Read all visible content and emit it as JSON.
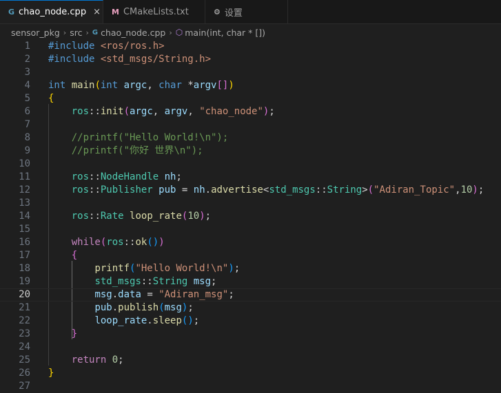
{
  "tabs": [
    {
      "icon": "C++",
      "label": "chao_node.cpp",
      "close": "×"
    },
    {
      "icon": "M",
      "label": "CMakeLists.txt"
    },
    {
      "icon": "⚙",
      "label": "设置"
    }
  ],
  "breadcrumb": {
    "folder1": "sensor_pkg",
    "folder2": "src",
    "file": "chao_node.cpp",
    "symbol": "main(int, char * [])",
    "separator": "›"
  },
  "editor": {
    "current_line": 20,
    "lines": [
      {
        "n": "1",
        "tokens": [
          [
            "#include ",
            "kw"
          ],
          [
            "<ros/ros.h>",
            "str"
          ]
        ]
      },
      {
        "n": "2",
        "tokens": [
          [
            "#include ",
            "kw"
          ],
          [
            "<std_msgs/String.h>",
            "str"
          ]
        ]
      },
      {
        "n": "3",
        "tokens": []
      },
      {
        "n": "4",
        "tokens": [
          [
            "int ",
            "kw"
          ],
          [
            "main",
            "fn"
          ],
          [
            "(",
            "br1"
          ],
          [
            "int ",
            "kw"
          ],
          [
            "argc",
            "var"
          ],
          [
            ", ",
            "pl"
          ],
          [
            "char ",
            "kw"
          ],
          [
            "*",
            "pl"
          ],
          [
            "argv",
            "var"
          ],
          [
            "[]",
            "br2"
          ],
          [
            ")",
            "br1"
          ]
        ]
      },
      {
        "n": "5",
        "tokens": [
          [
            "{",
            "br1"
          ]
        ]
      },
      {
        "n": "6",
        "tokens": [
          [
            "    ",
            "pl"
          ],
          [
            "ros",
            "ns"
          ],
          [
            "::",
            "pl"
          ],
          [
            "init",
            "fn"
          ],
          [
            "(",
            "br2"
          ],
          [
            "argc",
            "var"
          ],
          [
            ", ",
            "pl"
          ],
          [
            "argv",
            "var"
          ],
          [
            ", ",
            "pl"
          ],
          [
            "\"chao_node\"",
            "str"
          ],
          [
            ")",
            "br2"
          ],
          [
            ";",
            "pl"
          ]
        ]
      },
      {
        "n": "7",
        "tokens": []
      },
      {
        "n": "8",
        "tokens": [
          [
            "    ",
            "pl"
          ],
          [
            "//printf(\"Hello World!\\n\");",
            "com"
          ]
        ]
      },
      {
        "n": "9",
        "tokens": [
          [
            "    ",
            "pl"
          ],
          [
            "//printf(\"你好 世界\\n\");",
            "com"
          ]
        ]
      },
      {
        "n": "10",
        "tokens": []
      },
      {
        "n": "11",
        "tokens": [
          [
            "    ",
            "pl"
          ],
          [
            "ros",
            "ns"
          ],
          [
            "::",
            "pl"
          ],
          [
            "NodeHandle ",
            "type"
          ],
          [
            "nh",
            "var"
          ],
          [
            ";",
            "pl"
          ]
        ]
      },
      {
        "n": "12",
        "tokens": [
          [
            "    ",
            "pl"
          ],
          [
            "ros",
            "ns"
          ],
          [
            "::",
            "pl"
          ],
          [
            "Publisher ",
            "type"
          ],
          [
            "pub",
            "var"
          ],
          [
            " = ",
            "pl"
          ],
          [
            "nh",
            "var"
          ],
          [
            ".",
            "pl"
          ],
          [
            "advertise",
            "fn"
          ],
          [
            "<",
            "pl"
          ],
          [
            "std_msgs",
            "ns"
          ],
          [
            "::",
            "pl"
          ],
          [
            "String",
            "type"
          ],
          [
            ">",
            "pl"
          ],
          [
            "(",
            "br2"
          ],
          [
            "\"Adiran_Topic\"",
            "str"
          ],
          [
            ",",
            "pl"
          ],
          [
            "10",
            "num"
          ],
          [
            ")",
            "br2"
          ],
          [
            ";",
            "pl"
          ]
        ]
      },
      {
        "n": "13",
        "tokens": []
      },
      {
        "n": "14",
        "tokens": [
          [
            "    ",
            "pl"
          ],
          [
            "ros",
            "ns"
          ],
          [
            "::",
            "pl"
          ],
          [
            "Rate ",
            "type"
          ],
          [
            "loop_rate",
            "fn"
          ],
          [
            "(",
            "br2"
          ],
          [
            "10",
            "num"
          ],
          [
            ")",
            "br2"
          ],
          [
            ";",
            "pl"
          ]
        ]
      },
      {
        "n": "15",
        "tokens": []
      },
      {
        "n": "16",
        "tokens": [
          [
            "    ",
            "pl"
          ],
          [
            "while",
            "ctrl"
          ],
          [
            "(",
            "br2"
          ],
          [
            "ros",
            "ns"
          ],
          [
            "::",
            "pl"
          ],
          [
            "ok",
            "fn"
          ],
          [
            "()",
            "br3"
          ],
          [
            ")",
            "br2"
          ]
        ]
      },
      {
        "n": "17",
        "tokens": [
          [
            "    ",
            "pl"
          ],
          [
            "{",
            "br2"
          ]
        ]
      },
      {
        "n": "18",
        "tokens": [
          [
            "        ",
            "pl"
          ],
          [
            "printf",
            "fn"
          ],
          [
            "(",
            "br3"
          ],
          [
            "\"Hello World!\\n\"",
            "str"
          ],
          [
            ")",
            "br3"
          ],
          [
            ";",
            "pl"
          ]
        ]
      },
      {
        "n": "19",
        "tokens": [
          [
            "        ",
            "pl"
          ],
          [
            "std_msgs",
            "ns"
          ],
          [
            "::",
            "pl"
          ],
          [
            "String ",
            "type"
          ],
          [
            "msg",
            "var"
          ],
          [
            ";",
            "pl"
          ]
        ]
      },
      {
        "n": "20",
        "tokens": [
          [
            "        ",
            "pl"
          ],
          [
            "msg",
            "var"
          ],
          [
            ".",
            "pl"
          ],
          [
            "data",
            "var"
          ],
          [
            " = ",
            "pl"
          ],
          [
            "\"Adiran_msg\"",
            "str"
          ],
          [
            ";",
            "pl"
          ]
        ]
      },
      {
        "n": "21",
        "tokens": [
          [
            "        ",
            "pl"
          ],
          [
            "pub",
            "var"
          ],
          [
            ".",
            "pl"
          ],
          [
            "publish",
            "fn"
          ],
          [
            "(",
            "br3"
          ],
          [
            "msg",
            "var"
          ],
          [
            ")",
            "br3"
          ],
          [
            ";",
            "pl"
          ]
        ]
      },
      {
        "n": "22",
        "tokens": [
          [
            "        ",
            "pl"
          ],
          [
            "loop_rate",
            "var"
          ],
          [
            ".",
            "pl"
          ],
          [
            "sleep",
            "fn"
          ],
          [
            "()",
            "br3"
          ],
          [
            ";",
            "pl"
          ]
        ]
      },
      {
        "n": "23",
        "tokens": [
          [
            "    ",
            "pl"
          ],
          [
            "}",
            "br2"
          ]
        ]
      },
      {
        "n": "24",
        "tokens": []
      },
      {
        "n": "25",
        "tokens": [
          [
            "    ",
            "pl"
          ],
          [
            "return ",
            "ctrl"
          ],
          [
            "0",
            "num"
          ],
          [
            ";",
            "pl"
          ]
        ]
      },
      {
        "n": "26",
        "tokens": [
          [
            "}",
            "br1"
          ]
        ]
      },
      {
        "n": "27",
        "tokens": []
      }
    ]
  }
}
